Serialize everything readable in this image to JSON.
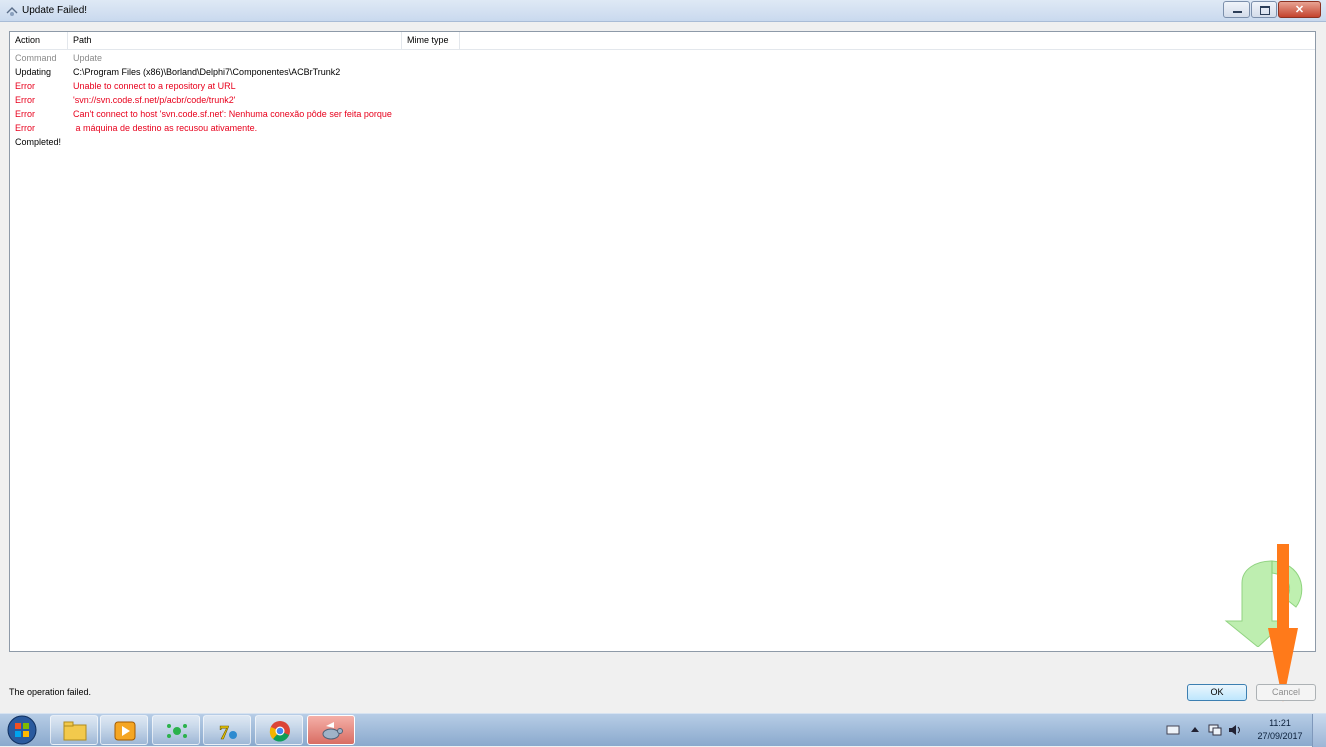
{
  "window": {
    "title": "Update Failed!",
    "icon": "tortoise-update-icon",
    "controls": [
      "minimize-icon",
      "restore-icon",
      "close-icon"
    ]
  },
  "list": {
    "columns": [
      "Action",
      "Path",
      "Mime type"
    ],
    "rows": [
      {
        "action": "Command",
        "path": "Update",
        "style": "gray"
      },
      {
        "action": "Updating",
        "path": "C:\\Program Files (x86)\\Borland\\Delphi7\\Componentes\\ACBrTrunk2",
        "style": "black"
      },
      {
        "action": "Error",
        "path": "Unable to connect to a repository at URL",
        "style": "red"
      },
      {
        "action": "Error",
        "path": "'svn://svn.code.sf.net/p/acbr/code/trunk2'",
        "style": "red"
      },
      {
        "action": "Error",
        "path": "Can't connect to host 'svn.code.sf.net': Nenhuma conexão pôde ser feita porque",
        "style": "red"
      },
      {
        "action": "Error",
        "path": " a máquina de destino as recusou ativamente.",
        "style": "red"
      },
      {
        "action": "Completed!",
        "path": "",
        "style": "black"
      }
    ]
  },
  "status": {
    "message": "The operation failed."
  },
  "buttons": {
    "ok": "OK",
    "cancel": "Cancel"
  },
  "taskbar": {
    "items": [
      "start-orb-icon",
      "file-explorer-icon",
      "media-player-icon",
      "network-app-icon",
      "delphi7-icon",
      "chrome-icon",
      "tortoisesvn-icon"
    ],
    "clock_time": "11:21",
    "clock_date": "27/09/2017"
  },
  "colors": {
    "error_red": "#e8001c",
    "annotation_orange": "#ff7a1a",
    "arrow_green": "#7fd86a"
  }
}
